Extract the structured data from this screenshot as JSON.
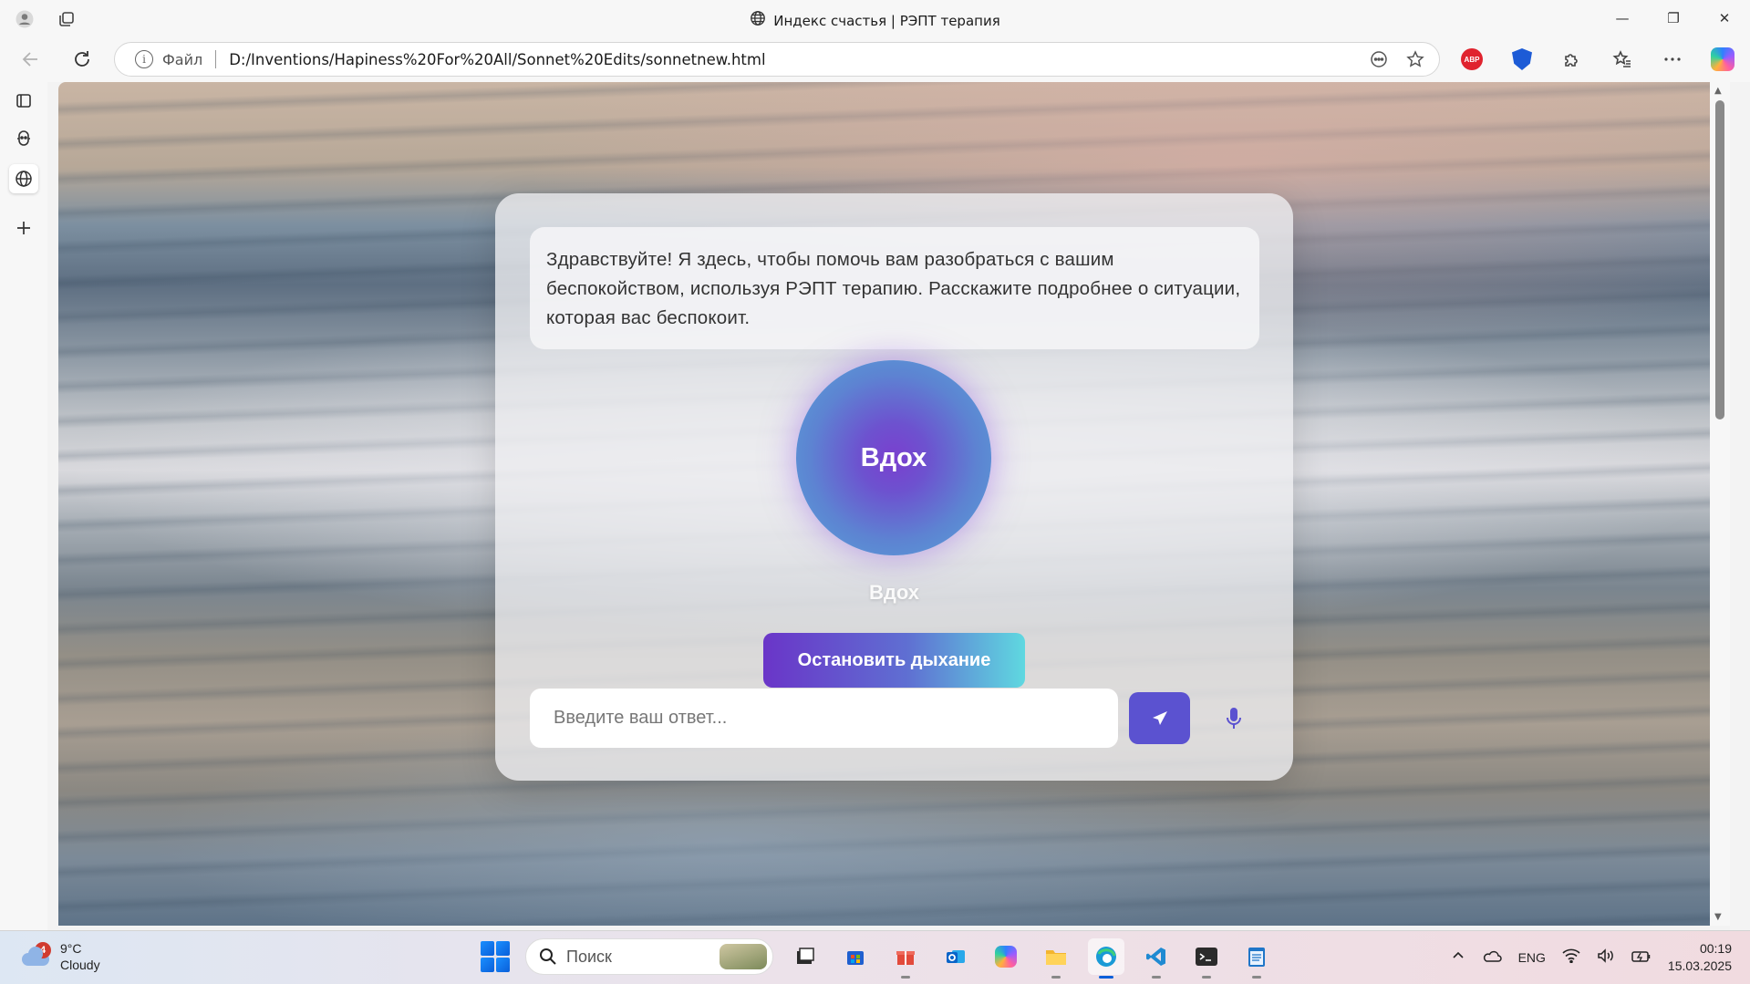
{
  "window": {
    "title": "Индекс счастья | РЭПТ терапия",
    "minimize_glyph": "—",
    "restore_glyph": "❐",
    "close_glyph": "✕"
  },
  "address_bar": {
    "file_label": "Файл",
    "url": "D:/Inventions/Hapiness%20For%20All/Sonnet%20Edits/sonnetnew.html"
  },
  "extensions": {
    "abp_label": "ABP"
  },
  "chat": {
    "greeting": "Здравствуйте! Я здесь, чтобы помочь вам разобраться с вашим беспокойством, используя РЭПТ терапию. Расскажите подробнее о ситуации, которая вас беспокоит.",
    "breath_circle_text": "Вдох",
    "breath_phase_label": "Вдох",
    "stop_button_label": "Остановить дыхание",
    "answer_placeholder": "Введите ваш ответ..."
  },
  "colors": {
    "button_gradient_start": "#6a35c8",
    "button_gradient_end": "#5fd8e0",
    "send_button": "#5b52d0",
    "mic_icon": "#5b52d0",
    "abp_red": "#e0232e"
  },
  "taskbar": {
    "weather": {
      "temperature": "9°C",
      "condition": "Cloudy",
      "badge_count": "4"
    },
    "search_placeholder": "Поиск",
    "tray": {
      "language": "ENG",
      "time": "00:19",
      "date": "15.03.2025"
    }
  },
  "icons": [
    "profile-icon",
    "tabs-icon",
    "globe-icon",
    "back-icon",
    "reload-icon",
    "info-icon",
    "reader-icon",
    "favorite-star-icon",
    "abp-extension-icon",
    "shield-extension-icon",
    "extensions-puzzle-icon",
    "favorites-icon",
    "more-icon",
    "copilot-icon",
    "collections-icon",
    "copilot-sidebar-icon",
    "add-icon",
    "send-icon",
    "microphone-icon",
    "windows-start-icon",
    "search-icon",
    "cloud-icon",
    "wifi-icon",
    "volume-icon",
    "battery-icon"
  ]
}
